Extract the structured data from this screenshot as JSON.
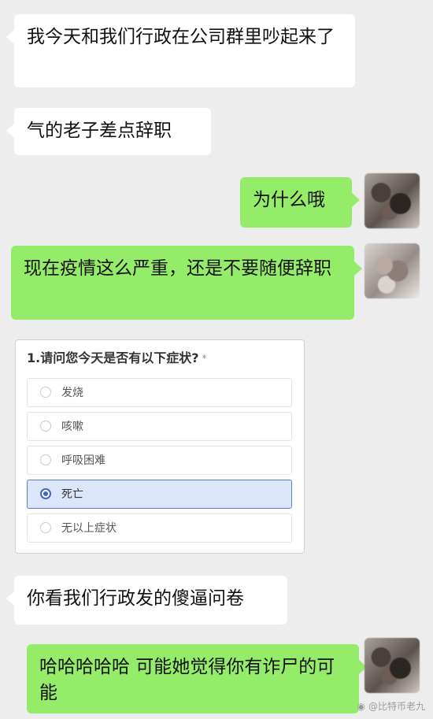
{
  "chat": {
    "messages": [
      {
        "text": "我今天和我们行政在公司群里吵起来了"
      },
      {
        "text": "气的老子差点辞职"
      },
      {
        "text": "为什么哦"
      },
      {
        "text": "现在疫情这么严重，还是不要随便辞职"
      },
      {
        "text": "你看我们行政发的傻逼问卷"
      },
      {
        "text": "哈哈哈哈哈 可能她觉得你有诈尸的可能"
      }
    ]
  },
  "survey": {
    "question": "1.请问您今天是否有以下症状?",
    "required_mark": "*",
    "options": [
      {
        "label": "发烧"
      },
      {
        "label": "咳嗽"
      },
      {
        "label": "呼吸困难"
      },
      {
        "label": "死亡"
      },
      {
        "label": "无以上症状"
      }
    ],
    "selected": "死亡"
  },
  "watermark": {
    "text": "@比特币老九"
  },
  "colors": {
    "background": "#ededed",
    "incoming_bubble": "#ffffff",
    "outgoing_bubble": "#95ec69",
    "selected_option": "#dbe6fb",
    "selected_radio": "#3f67c7"
  }
}
